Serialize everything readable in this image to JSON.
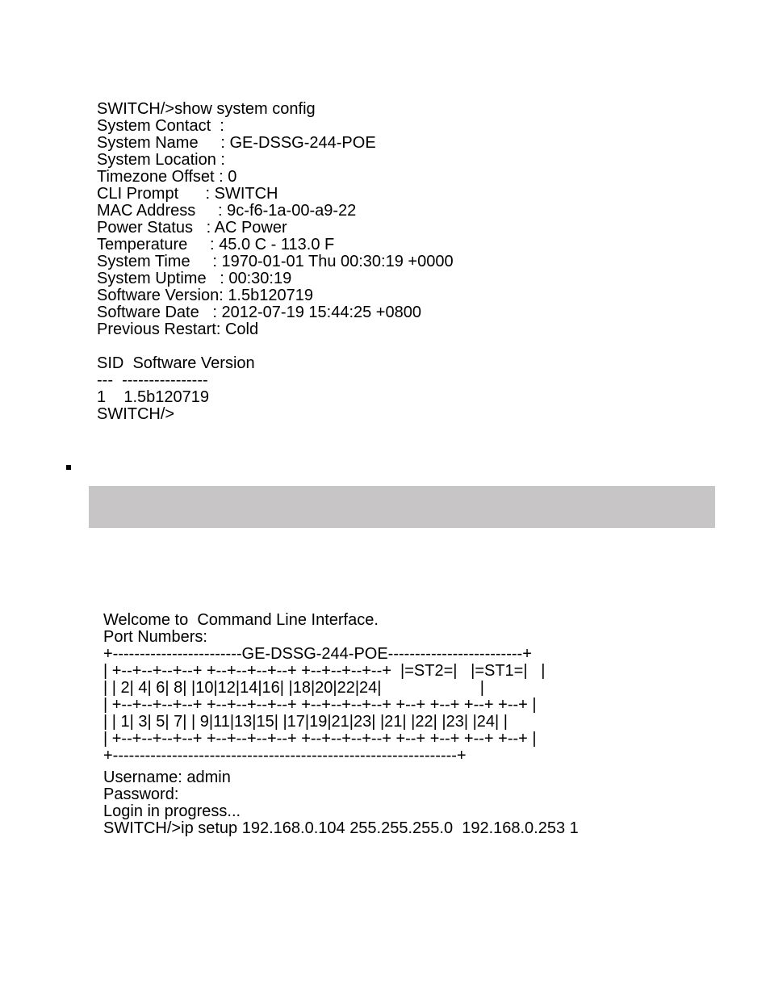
{
  "terminal_top": {
    "cmd_prompt": "SWITCH/>",
    "cmd_string": "show system config",
    "fields": {
      "system_contact_label": "System Contact  :",
      "system_contact_value": "",
      "system_name_label": "System Name     :",
      "system_name_value": "GE-DSSG-244-POE",
      "system_location_label": "System Location :",
      "system_location_value": "",
      "timezone_offset_label": "Timezone Offset :",
      "timezone_offset_value": "0",
      "cli_prompt_label": "CLI Prompt      :",
      "cli_prompt_value": "SWITCH",
      "mac_address_label": "MAC Address     :",
      "mac_address_value": "9c-f6-1a-00-a9-22",
      "power_status_label": "Power Status   :",
      "power_status_value": "AC Power",
      "temperature_label": "Temperature     :",
      "temperature_value": "45.0 C - 113.0 F",
      "system_time_label": "System Time     :",
      "system_time_value": "1970-01-01 Thu 00:30:19 +0000",
      "system_uptime_label": "System Uptime   :",
      "system_uptime_value": "00:30:19",
      "sw_version_label": "Software Version:",
      "sw_version_value": "1.5b120719",
      "sw_date_label": "Software Date   :",
      "sw_date_value": "2012-07-19 15:44:25 +0800",
      "prev_restart_label": "Previous Restart:",
      "prev_restart_value": "Cold"
    },
    "table": {
      "header": "SID  Software Version",
      "divider": "---  ----------------",
      "row_sid": "1",
      "row_ver": "1.5b120719"
    },
    "end_prompt": "SWITCH/>"
  },
  "terminal_bottom": {
    "welcome": "Welcome to  Command Line Interface.",
    "port_numbers_label": "Port Numbers:",
    "ascii_art": {
      "l1": "+------------------------GE-DSSG-244-POE-------------------------+",
      "l2": "| +--+--+--+--+ +--+--+--+--+ +--+--+--+--+  |=ST2=|   |=ST1=|   |",
      "l3": "| | 2| 4| 6| 8| |10|12|14|16| |18|20|22|24|                      |",
      "l4": "| +--+--+--+--+ +--+--+--+--+ +--+--+--+--+ +--+ +--+ +--+ +--+ |",
      "l5": "| | 1| 3| 5| 7| | 9|11|13|15| |17|19|21|23| |21| |22| |23| |24| |",
      "l6": "| +--+--+--+--+ +--+--+--+--+ +--+--+--+--+ +--+ +--+ +--+ +--+ |",
      "l7": "+----------------------------------------------------------------+"
    },
    "login": {
      "username_label": "Username:",
      "username_value": "admin",
      "password_label": "Password:",
      "login_progress": "Login in progress...",
      "ip_cmd_prompt": "SWITCH/>",
      "ip_cmd_string": "ip setup 192.168.0.104 255.255.255.0  192.168.0.253 1"
    }
  }
}
